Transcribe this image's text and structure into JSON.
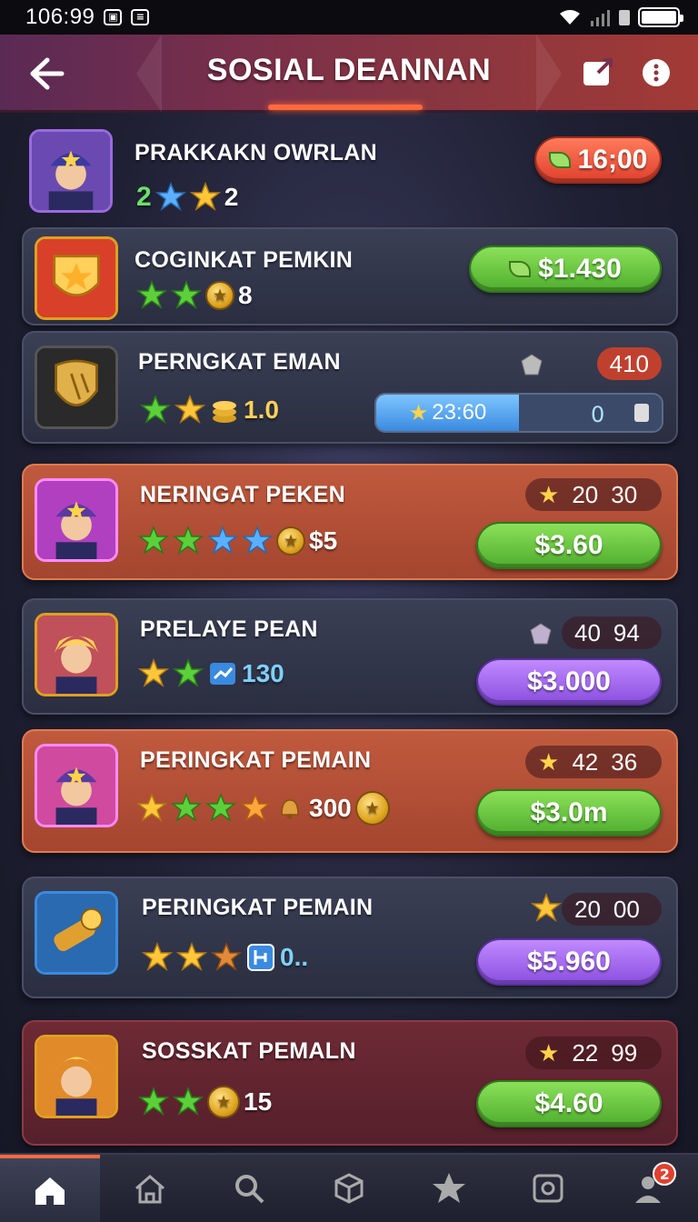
{
  "status_bar": {
    "time": "106:99"
  },
  "header": {
    "title": "SOSIAL DEANNAN"
  },
  "rows": [
    {
      "name": "PRAKKAKN OWRLAN",
      "rating": "2",
      "price": "16;00",
      "price_style": "red"
    },
    {
      "name": "COGINKAT PEMKIN",
      "rating": "8",
      "price": "$1.430",
      "price_style": "green"
    },
    {
      "name": "PERNGKAT EMAN",
      "rating": "1.0",
      "stat": "410",
      "progress_label": "23:60",
      "progress_value": "0",
      "progress_fraction": 0.5
    },
    {
      "name": "NERINGAT PEKEN",
      "rating": "$5",
      "stat_a": "20",
      "stat_b": "30",
      "price": "$3.60",
      "price_style": "green"
    },
    {
      "name": "PRELAYE PEAN",
      "rating": "130",
      "stat_a": "40",
      "stat_b": "94",
      "price": "$3.000",
      "price_style": "purple"
    },
    {
      "name": "PERINGKAT PEMAIN",
      "rating": "300",
      "stat_a": "42",
      "stat_b": "36",
      "price": "$3.0m",
      "price_style": "green"
    },
    {
      "name": "PERINGKAT PEMAIN",
      "rating": "0..",
      "stat_a": "20",
      "stat_b": "00",
      "price": "$5.960",
      "price_style": "purple"
    },
    {
      "name": "SOSSKAT PEMALN",
      "rating": "15",
      "stat_a": "22",
      "stat_b": "99",
      "price": "$4.60",
      "price_style": "green"
    }
  ],
  "nav": {
    "tabs": [
      "home",
      "home-outline",
      "search",
      "box",
      "star",
      "camera",
      "profile"
    ],
    "notification_count": "2"
  },
  "colors": {
    "accent": "#ff6a3d",
    "green": "#4fae2e",
    "purple": "#8a4fe0",
    "header_red": "#a23a35"
  }
}
